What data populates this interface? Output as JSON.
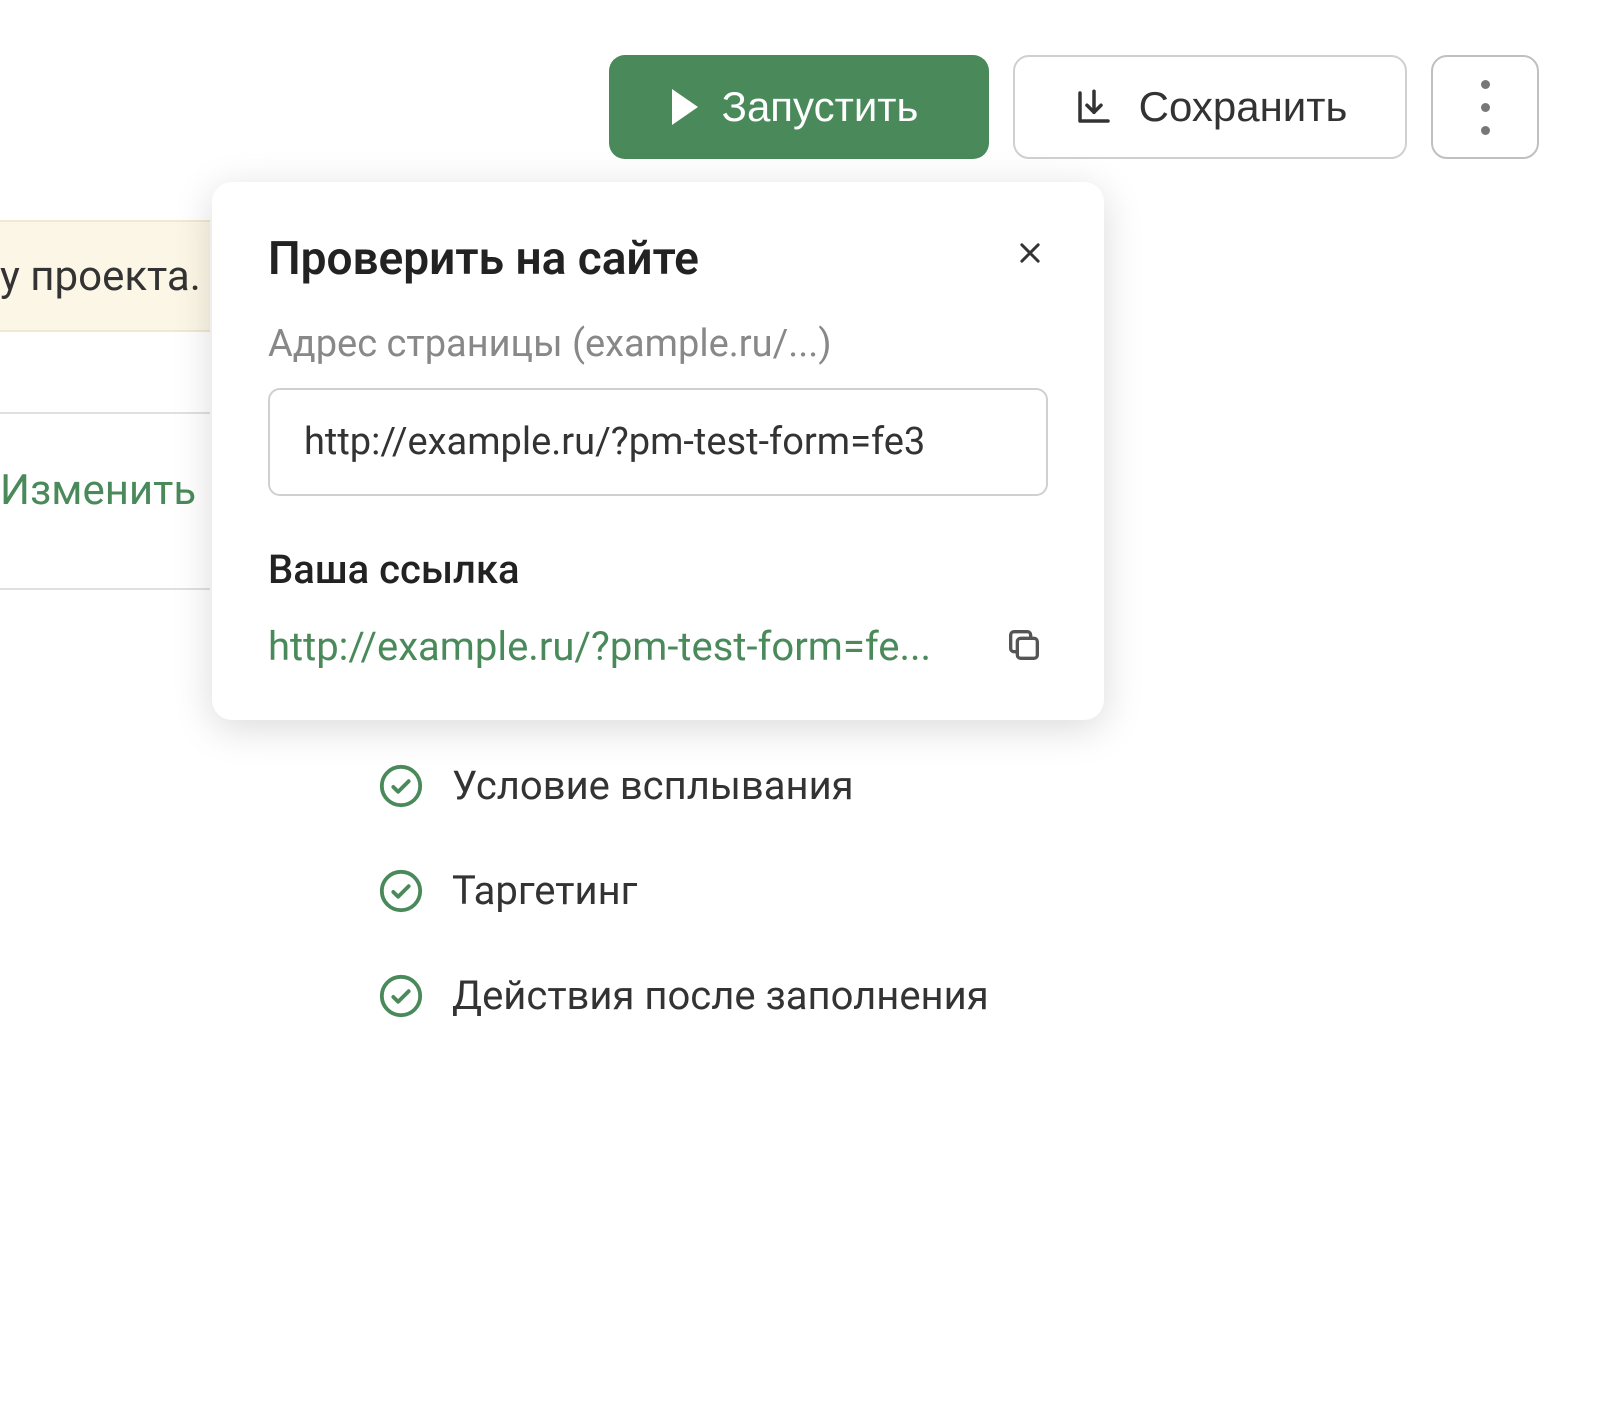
{
  "toolbar": {
    "run_label": "Запустить",
    "save_label": "Сохранить"
  },
  "banner": {
    "text_fragment": "у проекта."
  },
  "left": {
    "edit_link": "Изменить"
  },
  "popover": {
    "title": "Проверить на сайте",
    "address_label": "Адрес страницы (example.ru/...)",
    "url_value": "http://example.ru/?pm-test-form=fe3",
    "your_link_label": "Ваша ссылка",
    "link_text": "http://example.ru/?pm-test-form=fe..."
  },
  "checklist": {
    "items": [
      "Условие всплывания",
      "Таргетинг",
      "Действия после заполнения"
    ]
  },
  "colors": {
    "primary": "#4a8a5a",
    "banner_bg": "#fcf6e6"
  }
}
